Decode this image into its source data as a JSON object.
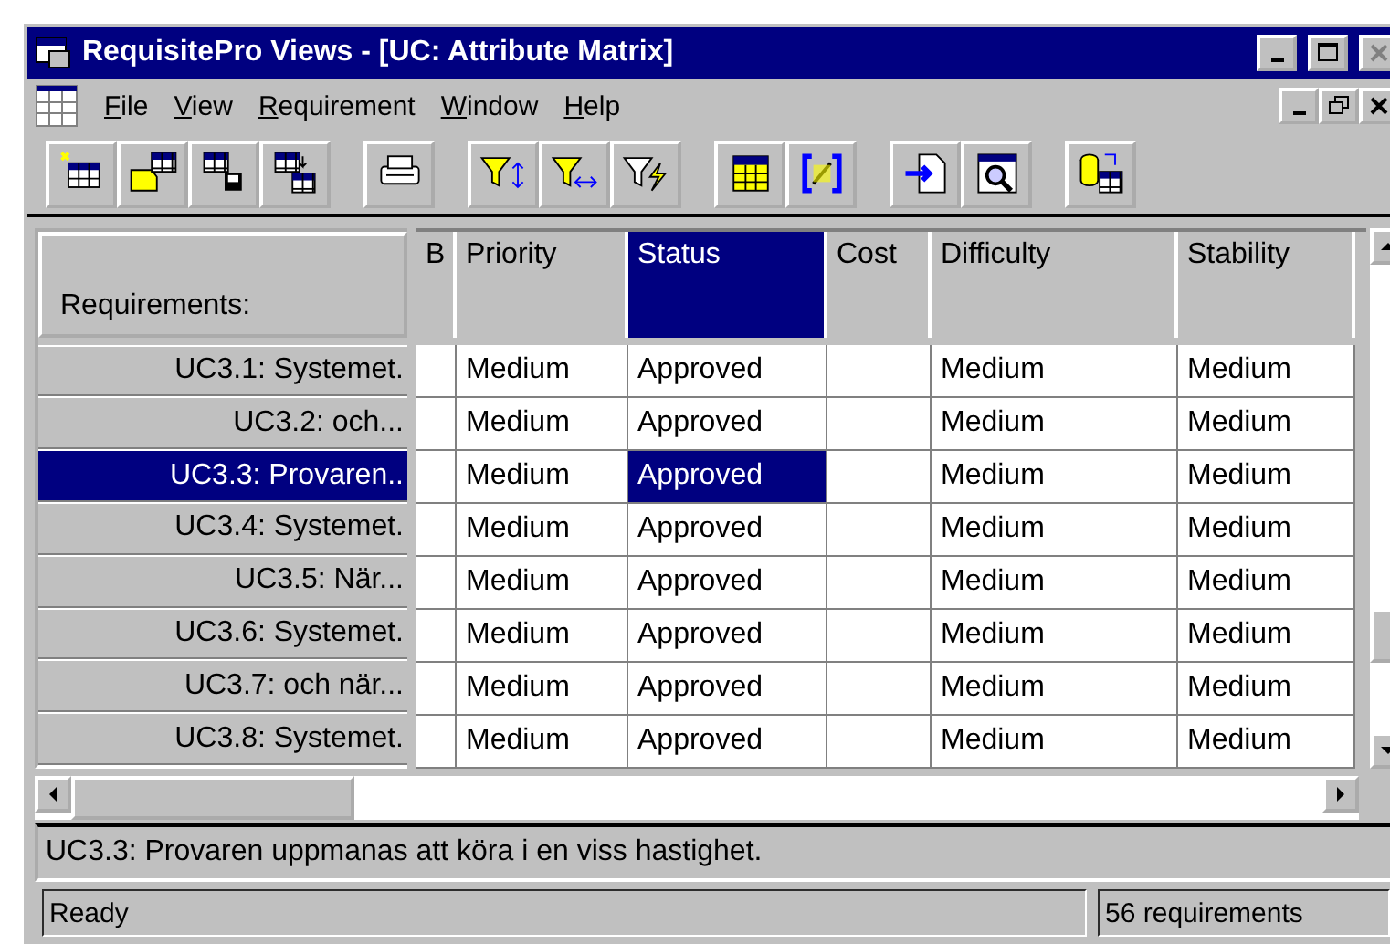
{
  "window": {
    "title": "RequisitePro Views - [UC: Attribute Matrix]"
  },
  "menu": [
    "File",
    "View",
    "Requirement",
    "Window",
    "Help"
  ],
  "toolbar": [
    [
      {
        "kind": "new-table"
      },
      {
        "kind": "open"
      },
      {
        "kind": "save-table"
      },
      {
        "kind": "export-table"
      }
    ],
    [
      {
        "kind": "print"
      }
    ],
    [
      {
        "kind": "filter-sort"
      },
      {
        "kind": "filter-columns"
      },
      {
        "kind": "filter-query"
      }
    ],
    [
      {
        "kind": "grid"
      },
      {
        "kind": "bracket"
      }
    ],
    [
      {
        "kind": "import"
      },
      {
        "kind": "inspect"
      }
    ],
    [
      {
        "kind": "database"
      }
    ]
  ],
  "matrix": {
    "row_header_title": "Requirements:",
    "columns": [
      {
        "label": "B",
        "selected": false
      },
      {
        "label": "Priority",
        "selected": false
      },
      {
        "label": "Status",
        "selected": true
      },
      {
        "label": "Cost",
        "selected": false
      },
      {
        "label": "Difficulty",
        "selected": false
      },
      {
        "label": "Stability",
        "selected": false
      }
    ],
    "rows": [
      {
        "name": "UC3.1: Systemet.",
        "selected": false,
        "cells": [
          "",
          "Medium",
          "Approved",
          "",
          "Medium",
          "Medium"
        ]
      },
      {
        "name": "UC3.2: och...",
        "selected": false,
        "cells": [
          "",
          "Medium",
          "Approved",
          "",
          "Medium",
          "Medium"
        ]
      },
      {
        "name": "UC3.3: Provaren..",
        "selected": true,
        "cells": [
          "",
          "Medium",
          "Approved",
          "",
          "Medium",
          "Medium"
        ]
      },
      {
        "name": "UC3.4: Systemet.",
        "selected": false,
        "cells": [
          "",
          "Medium",
          "Approved",
          "",
          "Medium",
          "Medium"
        ]
      },
      {
        "name": "UC3.5: När...",
        "selected": false,
        "cells": [
          "",
          "Medium",
          "Approved",
          "",
          "Medium",
          "Medium"
        ]
      },
      {
        "name": "UC3.6: Systemet.",
        "selected": false,
        "cells": [
          "",
          "Medium",
          "Approved",
          "",
          "Medium",
          "Medium"
        ]
      },
      {
        "name": "UC3.7: och när...",
        "selected": false,
        "cells": [
          "",
          "Medium",
          "Approved",
          "",
          "Medium",
          "Medium"
        ]
      },
      {
        "name": "UC3.8: Systemet.",
        "selected": false,
        "cells": [
          "",
          "Medium",
          "Approved",
          "",
          "Medium",
          "Medium"
        ]
      }
    ]
  },
  "description": "UC3.3: Provaren uppmanas att köra i en viss hastighet.",
  "status_bar": {
    "message": "Ready",
    "count": "56 requirements"
  }
}
